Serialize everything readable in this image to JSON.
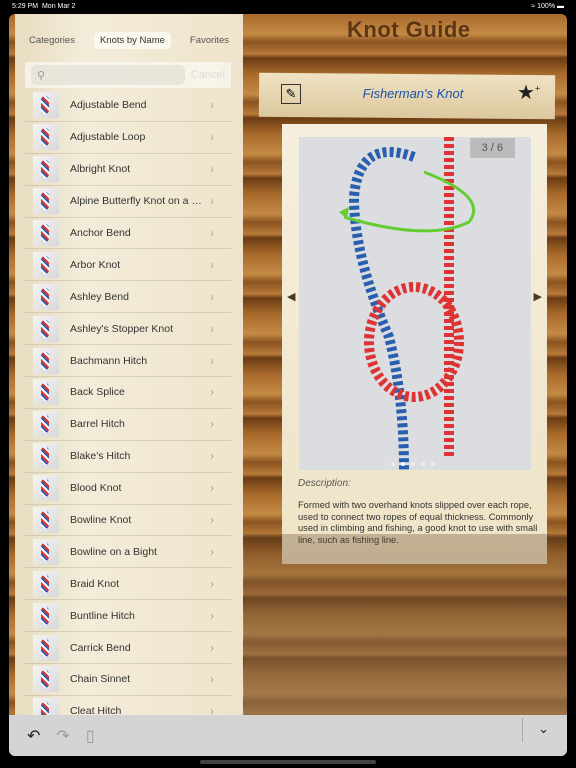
{
  "status": {
    "time": "5:29 PM",
    "date": "Mon Mar 2",
    "battery": "100%"
  },
  "app_title": "Knot Guide",
  "tabs": [
    {
      "label": "Categories"
    },
    {
      "label": "Knots by Name",
      "selected": true
    },
    {
      "label": "Favorites"
    }
  ],
  "search": {
    "placeholder": "",
    "cancel": "Cancel",
    "icon": "search-icon"
  },
  "knots": [
    "Adjustable Bend",
    "Adjustable Loop",
    "Albright Knot",
    "Alpine Butterfly Knot on a Bight",
    "Anchor Bend",
    "Arbor Knot",
    "Ashley Bend",
    "Ashley's Stopper Knot",
    "Bachmann Hitch",
    "Back Splice",
    "Barrel Hitch",
    "Blake's Hitch",
    "Blood Knot",
    "Bowline Knot",
    "Bowline on a Bight",
    "Braid Knot",
    "Buntline Hitch",
    "Carrick Bend",
    "Chain Sinnet",
    "Cleat Hitch"
  ],
  "detail": {
    "title": "Fisherman's Knot",
    "counter": "3 / 6",
    "current_step": 3,
    "total_steps": 6,
    "description_label": "Description:",
    "description": "Formed with two overhand knots slipped over each rope, used to connect two ropes of equal thickness. Commonly used in climbing and fishing, a good knot to use with small line, such as fishing line."
  },
  "colors": {
    "title_blue": "#1d50a8"
  }
}
